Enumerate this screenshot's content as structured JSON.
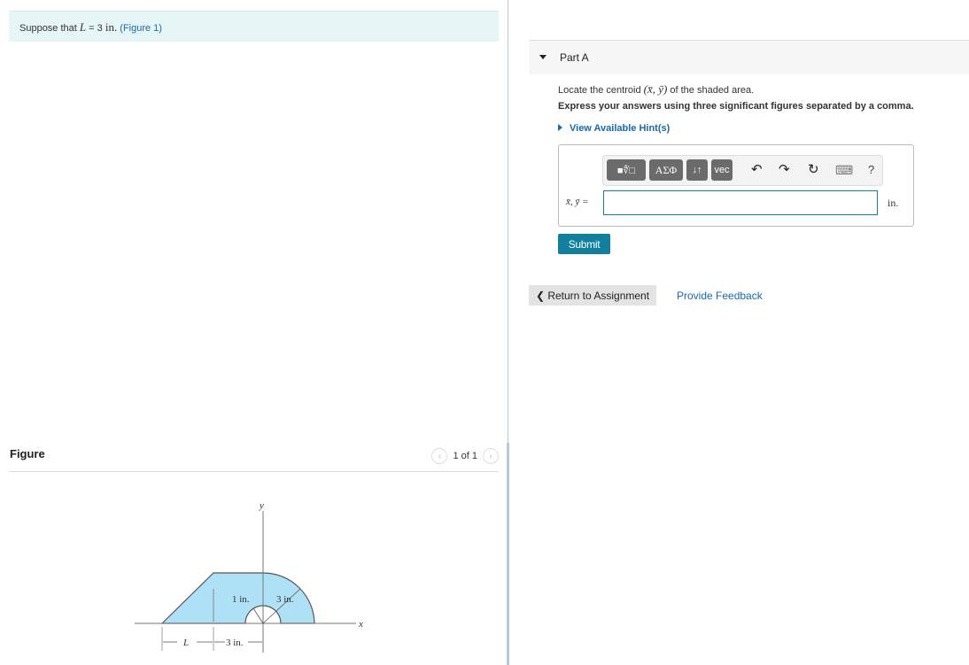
{
  "intro": {
    "prefix": "Suppose that ",
    "var": "L",
    "eq": " = 3 ",
    "unit": "in.",
    "figure_link": "(Figure 1)"
  },
  "figure": {
    "title": "Figure",
    "pager_text": "1 of 1",
    "prev_icon": "‹",
    "next_icon": "›",
    "labels": {
      "y_axis": "y",
      "x_axis": "x",
      "inner_radius": "1 in.",
      "outer_radius": "3 in.",
      "length_L": "L",
      "length_3": "3 in."
    }
  },
  "part": {
    "label": "Part A",
    "question_prefix": "Locate the centroid ",
    "question_math": "(x̄, ȳ)",
    "question_suffix": " of the shaded area.",
    "instruction": "Express your answers using three significant figures separated by a comma.",
    "hints_label": "View Available Hint(s)"
  },
  "toolbar": {
    "templates_btn": "■∜□",
    "greek_btn": "ΑΣΦ",
    "arrows_btn": "↓↑",
    "vec_btn": "vec",
    "undo_icon": "↶",
    "redo_icon": "↷",
    "reset_icon": "↻",
    "keyboard_icon": "⌨",
    "help_icon": "?"
  },
  "answer": {
    "label": "x̄, ȳ =",
    "value": "",
    "unit": "in."
  },
  "buttons": {
    "submit": "Submit",
    "return": "❮ Return to Assignment",
    "feedback": "Provide Feedback"
  }
}
